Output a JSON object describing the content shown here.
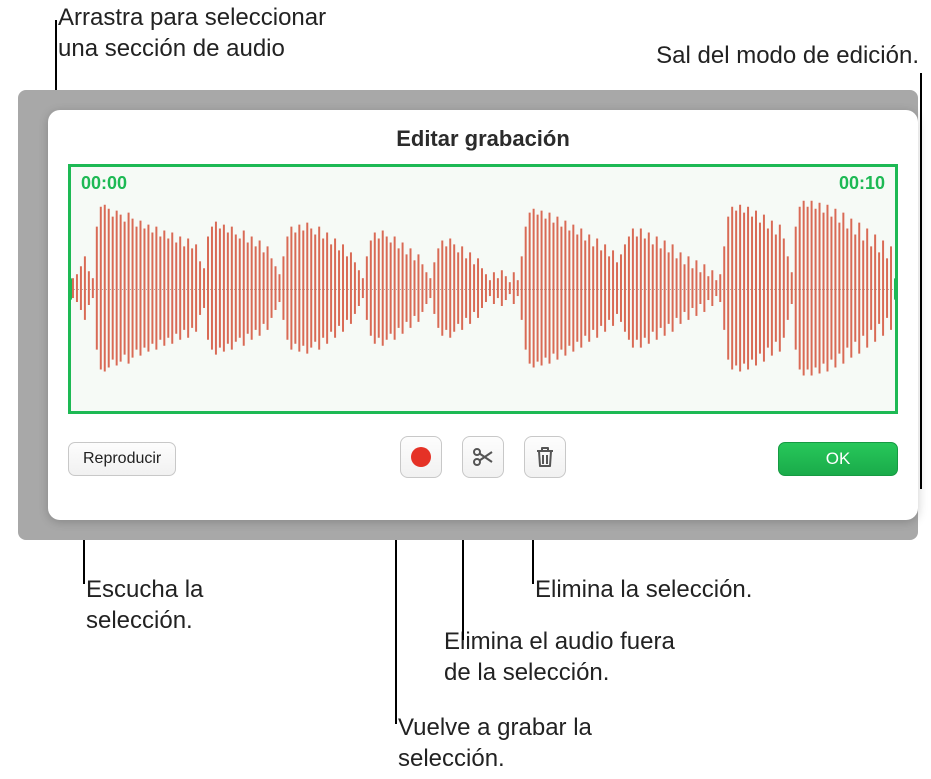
{
  "callouts": {
    "drag_select": "Arrastra para seleccionar\nuna sección de audio",
    "exit_edit": "Sal del modo de edición.",
    "listen": "Escucha la\nselección.",
    "delete_sel": "Elimina la selección.",
    "delete_outside": "Elimina el audio fuera\nde la selección.",
    "rerecord": "Vuelve a grabar la\nselección."
  },
  "panel": {
    "title": "Editar grabación",
    "time_start": "00:00",
    "time_end": "00:10",
    "play_label": "Reproducir",
    "ok_label": "OK"
  },
  "colors": {
    "accent": "#1db954",
    "record": "#e53226",
    "wave": "#d96a55"
  },
  "icons": {
    "record": "record-icon",
    "scissors": "scissors-icon",
    "trash": "trash-icon"
  }
}
